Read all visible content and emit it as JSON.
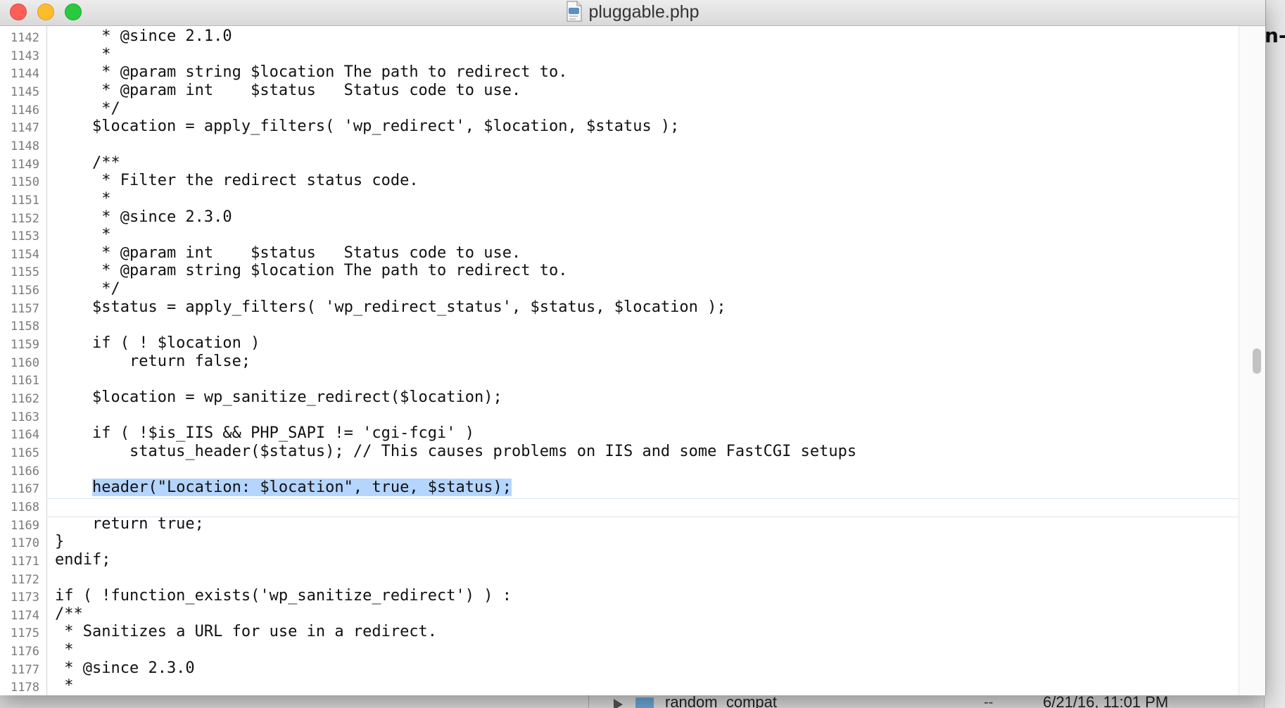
{
  "window": {
    "title": "pluggable.php",
    "file_icon": "php-document-icon"
  },
  "editor": {
    "highlighted_line": 1167,
    "selection_text": "header(\"Location: $location\", true, $status);",
    "scroll_position": 0.5,
    "lines": [
      {
        "n": "1142",
        "text": "     * @since 2.1.0"
      },
      {
        "n": "1143",
        "text": "     *"
      },
      {
        "n": "1144",
        "text": "     * @param string $location The path to redirect to."
      },
      {
        "n": "1145",
        "text": "     * @param int    $status   Status code to use."
      },
      {
        "n": "1146",
        "text": "     */"
      },
      {
        "n": "1147",
        "text": "    $location = apply_filters( 'wp_redirect', $location, $status );"
      },
      {
        "n": "1148",
        "text": ""
      },
      {
        "n": "1149",
        "text": "    /**"
      },
      {
        "n": "1150",
        "text": "     * Filter the redirect status code."
      },
      {
        "n": "1151",
        "text": "     *"
      },
      {
        "n": "1152",
        "text": "     * @since 2.3.0"
      },
      {
        "n": "1153",
        "text": "     *"
      },
      {
        "n": "1154",
        "text": "     * @param int    $status   Status code to use."
      },
      {
        "n": "1155",
        "text": "     * @param string $location The path to redirect to."
      },
      {
        "n": "1156",
        "text": "     */"
      },
      {
        "n": "1157",
        "text": "    $status = apply_filters( 'wp_redirect_status', $status, $location );"
      },
      {
        "n": "1158",
        "text": ""
      },
      {
        "n": "1159",
        "text": "    if ( ! $location )"
      },
      {
        "n": "1160",
        "text": "        return false;"
      },
      {
        "n": "1161",
        "text": ""
      },
      {
        "n": "1162",
        "text": "    $location = wp_sanitize_redirect($location);"
      },
      {
        "n": "1163",
        "text": ""
      },
      {
        "n": "1164",
        "text": "    if ( !$is_IIS && PHP_SAPI != 'cgi-fcgi' )"
      },
      {
        "n": "1165",
        "text": "        status_header($status); // This causes problems on IIS and some FastCGI setups"
      },
      {
        "n": "1166",
        "text": ""
      },
      {
        "n": "1167",
        "text": "    ",
        "selected": "header(\"Location: $location\", true, $status);"
      },
      {
        "n": "1168",
        "text": ""
      },
      {
        "n": "1169",
        "text": "    return true;"
      },
      {
        "n": "1170",
        "text": "}"
      },
      {
        "n": "1171",
        "text": "endif;"
      },
      {
        "n": "1172",
        "text": ""
      },
      {
        "n": "1173",
        "text": "if ( !function_exists('wp_sanitize_redirect') ) :"
      },
      {
        "n": "1174",
        "text": "/**"
      },
      {
        "n": "1175",
        "text": " * Sanitizes a URL for use in a redirect."
      },
      {
        "n": "1176",
        "text": " *"
      },
      {
        "n": "1177",
        "text": " * @since 2.3.0"
      },
      {
        "n": "1178",
        "text": " *"
      }
    ]
  },
  "background_window": {
    "row_name": "random_compat",
    "row_size": "--",
    "row_date": "6/21/16, 11:01 PM",
    "edge_text": "n-"
  },
  "colors": {
    "selection": "#b4d5fe",
    "close": "#fc5f57",
    "minimize": "#fdbc2e",
    "maximize": "#29c940"
  }
}
